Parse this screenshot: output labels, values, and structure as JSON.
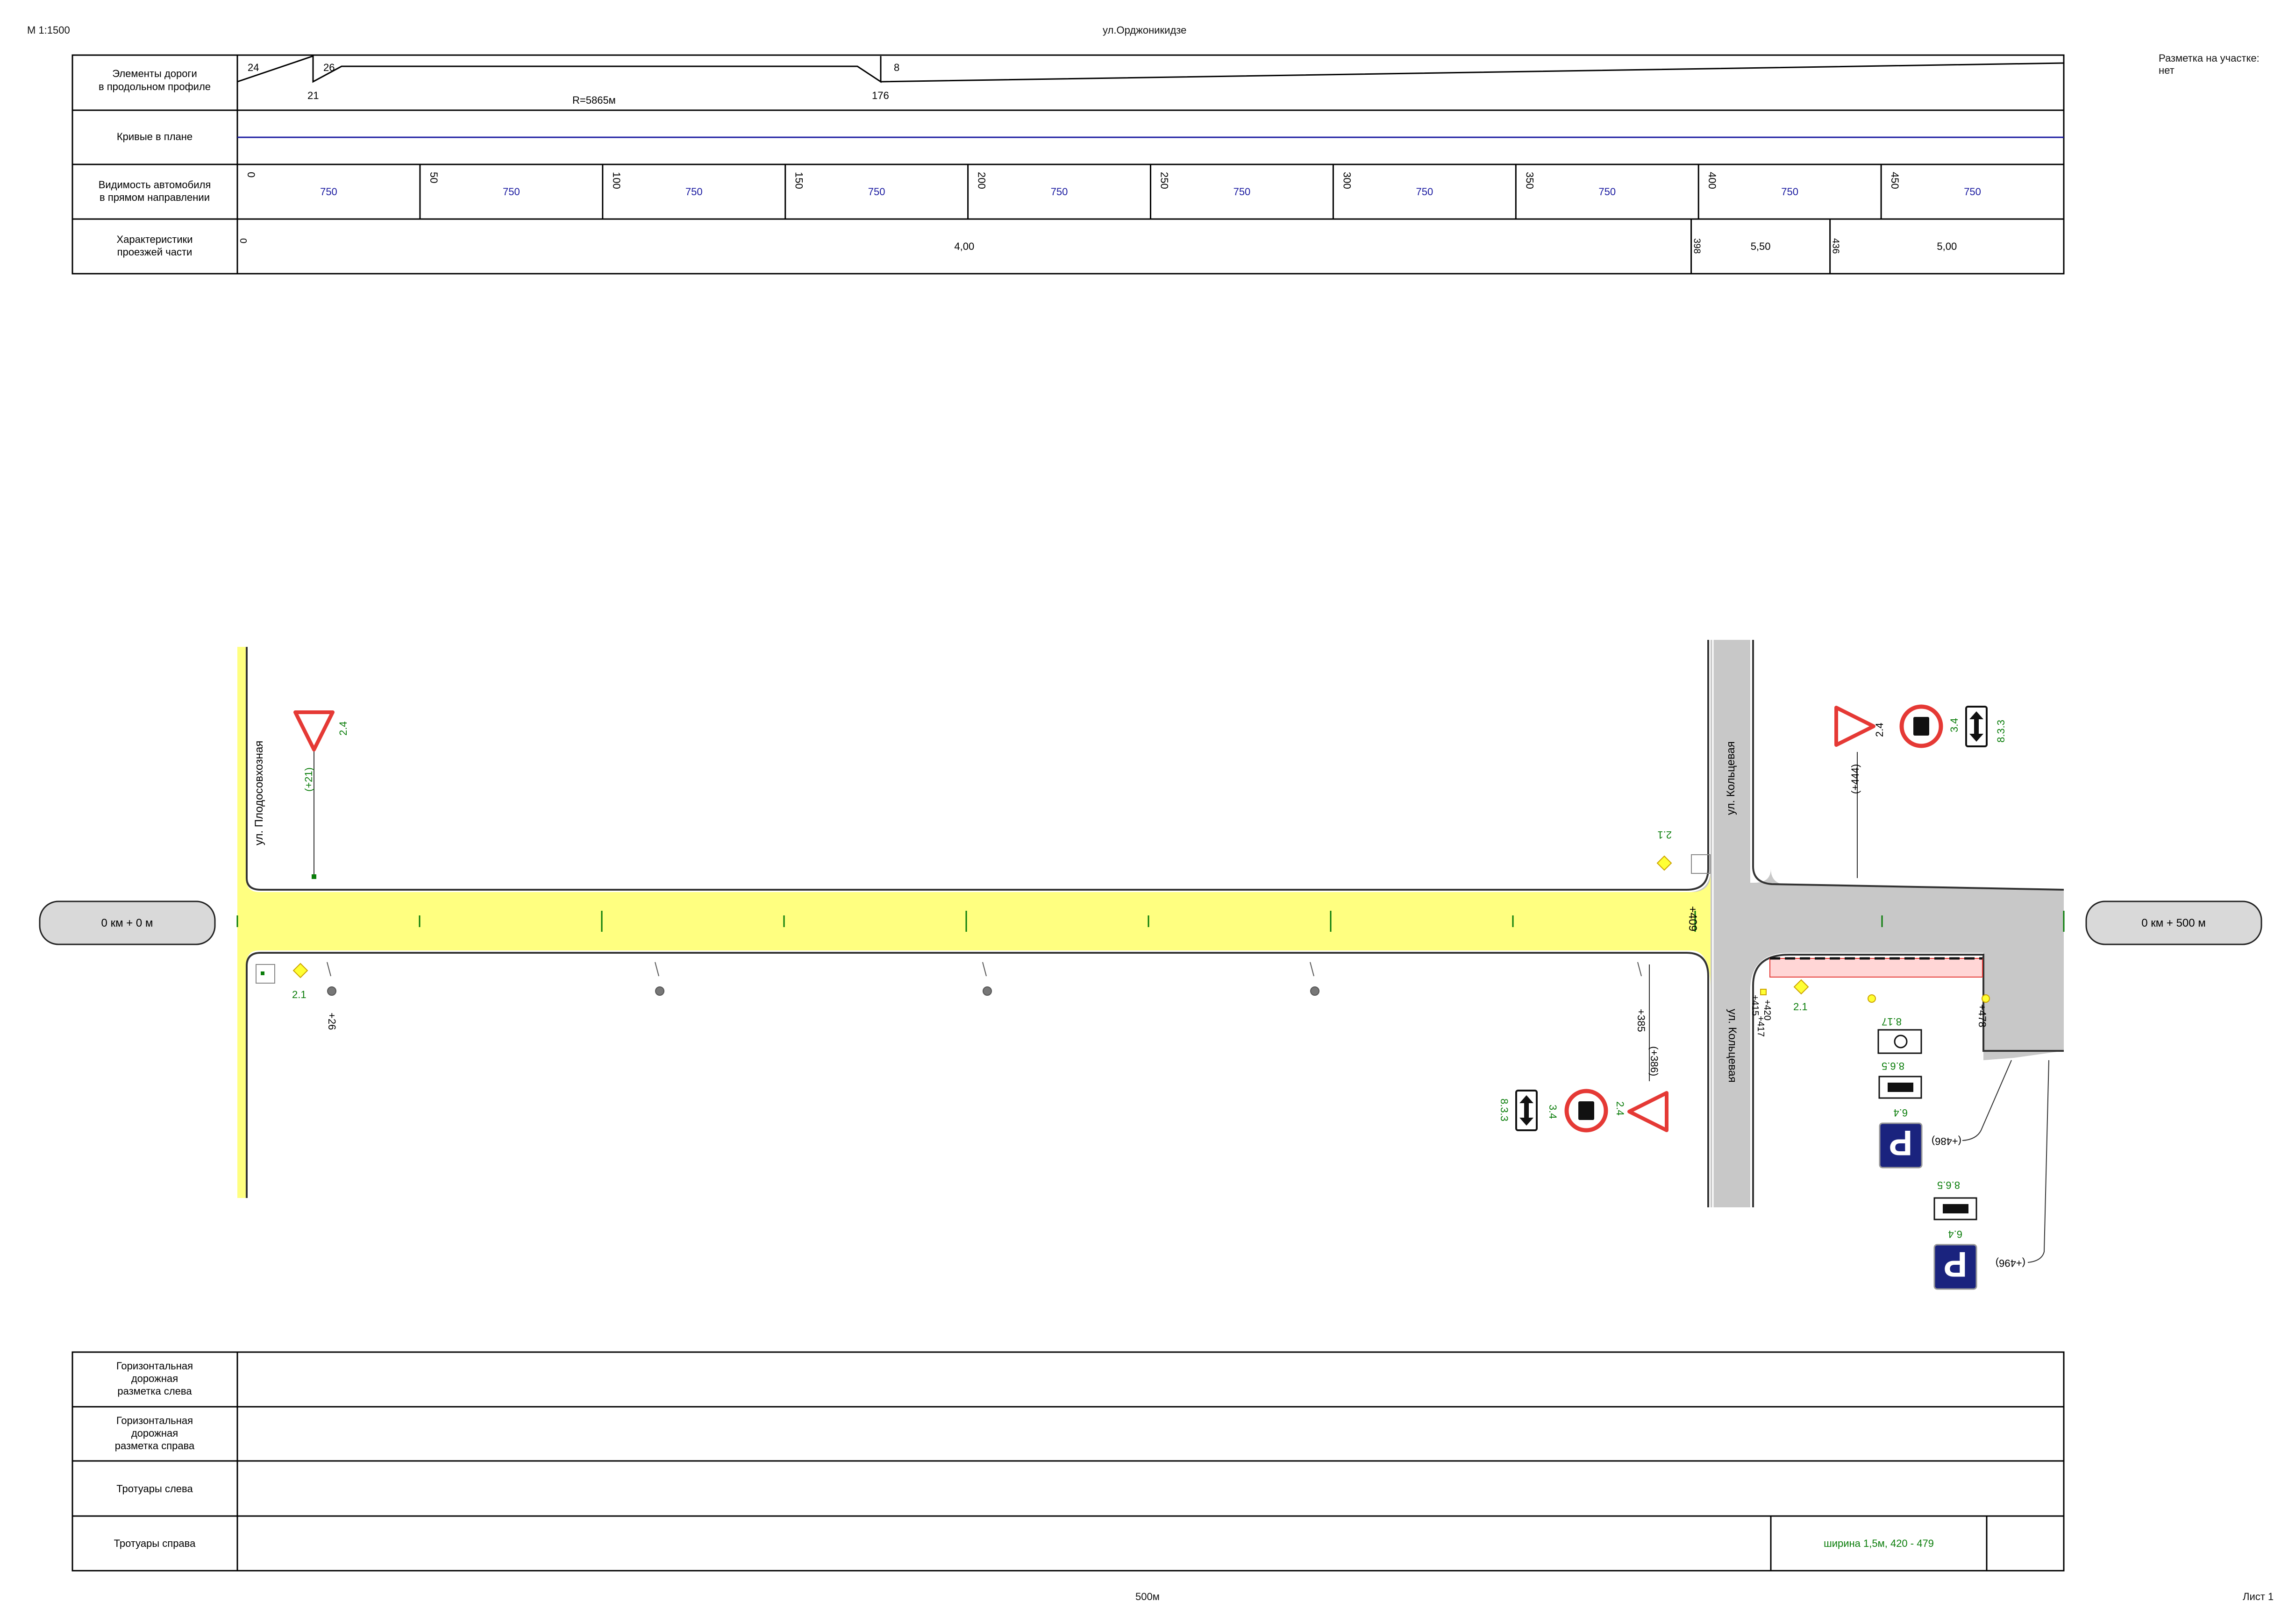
{
  "header": {
    "scale": "М 1:1500",
    "street": "ул.Орджоникидзе",
    "marking_note_line1": "Разметка на участке:",
    "marking_note_line2": "нет"
  },
  "footer": {
    "length": "500м",
    "sheet": "Лист 1"
  },
  "top_table": {
    "row_labels": {
      "profile": [
        "Элементы дороги",
        "в продольном профиле"
      ],
      "curves": [
        "Кривые в плане"
      ],
      "visibility": [
        "Видимость автомобиля",
        "в прямом направлении"
      ],
      "carriageway": [
        "Характеристики",
        "проезжей части"
      ]
    },
    "profile": {
      "grade_left": "24",
      "grade_mid": "26",
      "grade_right": "8",
      "break_1": "21",
      "break_2": "176",
      "radius": "R=5865м"
    },
    "visibility": [
      {
        "pk": "0",
        "value": "750"
      },
      {
        "pk": "50",
        "value": "750"
      },
      {
        "pk": "100",
        "value": "750"
      },
      {
        "pk": "150",
        "value": "750"
      },
      {
        "pk": "200",
        "value": "750"
      },
      {
        "pk": "250",
        "value": "750"
      },
      {
        "pk": "300",
        "value": "750"
      },
      {
        "pk": "350",
        "value": "750"
      },
      {
        "pk": "400",
        "value": "750"
      },
      {
        "pk": "450",
        "value": "750"
      }
    ],
    "carriageway": [
      {
        "pk": "0",
        "width": "4,00"
      },
      {
        "pk": "398",
        "width": "5,50"
      },
      {
        "pk": "436",
        "width": "5,00"
      }
    ]
  },
  "plan": {
    "start_marker": "0 км + 0 м",
    "end_marker": "0 км + 500 м",
    "street_left": "ул. Плодосовхозная",
    "street_right_top": "ул. Кольцевая",
    "street_right_bottom": "ул. Кольцевая",
    "pk_409": "+409",
    "signs": {
      "yield": "2.4",
      "main_road": "2.1",
      "no_trucks": "3.4",
      "both_dirs": "8.3.3",
      "parking": "6.4",
      "disabled": "8.17",
      "parking_method": "8.6.5"
    },
    "chainage": {
      "s21": "(+21)",
      "s26": "+26",
      "s385": "+385",
      "s386": "(+386)",
      "s444": "(+444)",
      "s417": "+417",
      "s415": "+415",
      "s420": "+420",
      "s478": "+478",
      "s486": "(+486)",
      "s496": "(+496)"
    },
    "colors": {
      "road_main": "#ffff80",
      "road_side": "#c8c8c8",
      "sign_red": "#e53935",
      "sign_blue": "#1a237e",
      "label_green": "#0a7d0a",
      "curve_blue": "#1a1aa0"
    }
  },
  "bottom_table": {
    "rows": [
      {
        "label": [
          "Горизонтальная",
          "дорожная",
          "разметка слева"
        ],
        "note": ""
      },
      {
        "label": [
          "Горизонтальная",
          "дорожная",
          "разметка справа"
        ],
        "note": ""
      },
      {
        "label": [
          "Тротуары слева"
        ],
        "note": ""
      },
      {
        "label": [
          "Тротуары справа"
        ],
        "note": "ширина 1,5м, 420 - 479"
      }
    ]
  }
}
